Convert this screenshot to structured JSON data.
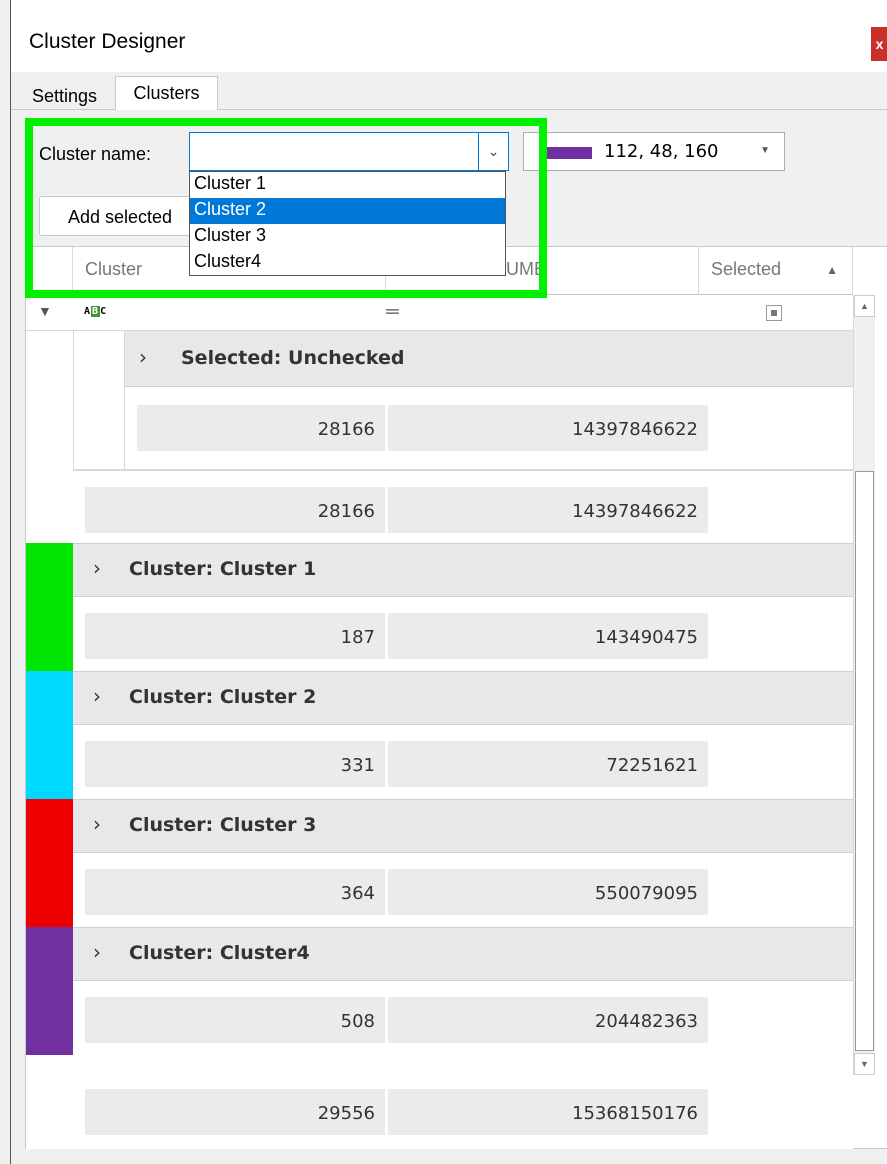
{
  "window": {
    "title": "Cluster Designer",
    "close_label": "x"
  },
  "tabs": [
    {
      "label": "Settings",
      "active": false
    },
    {
      "label": "Clusters",
      "active": true
    }
  ],
  "form": {
    "cluster_name_label": "Cluster name:",
    "cluster_name_value": "",
    "dropdown_items": [
      "Cluster 1",
      "Cluster 2",
      "Cluster 3",
      "Cluster4"
    ],
    "dropdown_selected": "Cluster 2",
    "color_value": "112, 48, 160",
    "color_hex": "#70309f",
    "add_button_label": "Add selected"
  },
  "grid": {
    "columns": [
      "Cluster",
      "UMB",
      "Selected"
    ],
    "rows": {
      "selected_group_label": "Selected: Unchecked",
      "selected_group_row": [
        "28166",
        "14397846622"
      ],
      "summary_row": [
        "28166",
        "14397846622"
      ],
      "groups": [
        {
          "label": "Cluster: Cluster 1",
          "color": "#00e600",
          "values": [
            "187",
            "143490475"
          ]
        },
        {
          "label": "Cluster: Cluster 2",
          "color": "#00d9ff",
          "values": [
            "331",
            "72251621"
          ]
        },
        {
          "label": "Cluster: Cluster 3",
          "color": "#ee0000",
          "values": [
            "364",
            "550079095"
          ]
        },
        {
          "label": "Cluster: Cluster4",
          "color": "#7030a0",
          "values": [
            "508",
            "204482363"
          ]
        }
      ],
      "total_row": [
        "29556",
        "15368150176"
      ]
    }
  },
  "icons": {
    "chevron": "chevron-right-icon",
    "filter": "filter-icon",
    "text_filter": "abc-filter-icon",
    "equals": "equals-filter-icon"
  }
}
